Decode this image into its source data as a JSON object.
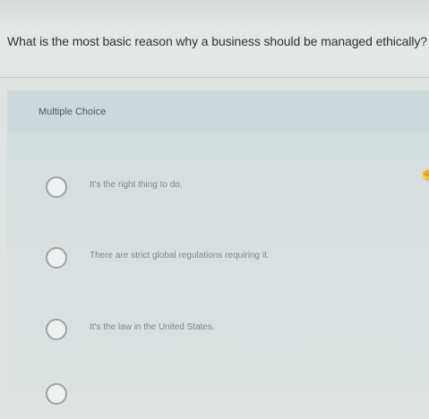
{
  "question": {
    "text": "What is the most basic reason why a business should be managed ethically?"
  },
  "answer_panel": {
    "type_label": "Multiple Choice",
    "options": [
      {
        "label": "It's the right thing to do."
      },
      {
        "label": "There are strict global regulations requiring it."
      },
      {
        "label": "It's the law in the United States."
      },
      {
        "label": ""
      }
    ]
  },
  "icons": {
    "radio": "radio-circle-icon",
    "cursor": "hand-pointer-icon"
  },
  "colors": {
    "page_bg": "#dfe3e2",
    "panel_bg": "#d2dcde",
    "text_dark": "#2b3337",
    "text_option": "#7d868a",
    "radio_border": "#9aa3a6"
  }
}
